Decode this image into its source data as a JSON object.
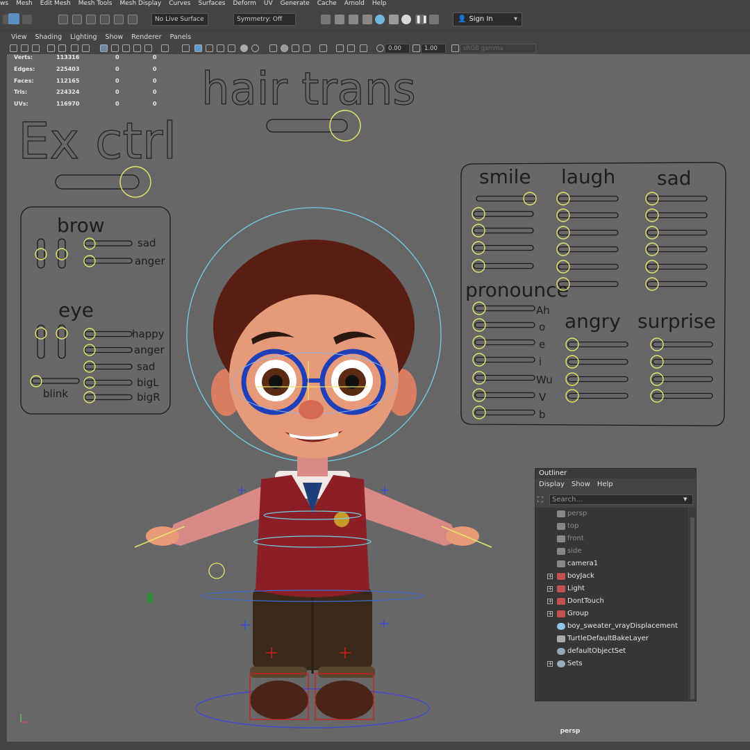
{
  "menubar": [
    "ws",
    "Mesh",
    "Edit Mesh",
    "Mesh Tools",
    "Mesh Display",
    "Curves",
    "Surfaces",
    "Deform",
    "UV",
    "Generate",
    "Cache",
    "Arnold",
    "Help"
  ],
  "toolbar": {
    "live_surface": "No Live Surface",
    "symmetry": "Symmetry: Off",
    "sign_in": "Sign In"
  },
  "panel_menu": [
    "View",
    "Shading",
    "Lighting",
    "Show",
    "Renderer",
    "Panels"
  ],
  "panel_toolbar": {
    "value_a": "0.00",
    "value_b": "1.00",
    "color_space": "sRGB gamma"
  },
  "hud": [
    {
      "label": "Verts:",
      "a": "113316",
      "b": "0",
      "c": "0"
    },
    {
      "label": "Edges:",
      "a": "225403",
      "b": "0",
      "c": "0"
    },
    {
      "label": "Faces:",
      "a": "112165",
      "b": "0",
      "c": "0"
    },
    {
      "label": "Tris:",
      "a": "224324",
      "b": "0",
      "c": "0"
    },
    {
      "label": "UVs:",
      "a": "116970",
      "b": "0",
      "c": "0"
    }
  ],
  "rig": {
    "hair_trans": "hair trans",
    "ex_ctrl": "Ex ctrl",
    "brow": {
      "title": "brow",
      "sliders": [
        "sad",
        "anger"
      ]
    },
    "eye": {
      "title": "eye",
      "sliders": [
        "happy",
        "anger",
        "sad",
        "bigL",
        "bigR"
      ],
      "blink": "blink"
    },
    "expressions": {
      "smile": "smile",
      "laugh": "laugh",
      "sad": "sad",
      "pronounce": "pronounce",
      "angry": "angry",
      "surprise": "surprise",
      "phonemes": [
        "Ah",
        "o",
        "e",
        "i",
        "Wu",
        "V",
        "b"
      ]
    }
  },
  "outliner": {
    "title": "Outliner",
    "menu": [
      "Display",
      "Show",
      "Help"
    ],
    "search_placeholder": "Search...",
    "items": [
      {
        "label": "persp",
        "icon": "camera-icon",
        "dim": true
      },
      {
        "label": "top",
        "icon": "camera-icon",
        "dim": true
      },
      {
        "label": "front",
        "icon": "camera-icon",
        "dim": true
      },
      {
        "label": "side",
        "icon": "camera-icon",
        "dim": true
      },
      {
        "label": "camera1",
        "icon": "camera-icon",
        "dim": false
      },
      {
        "label": "boyJack",
        "icon": "group-icon",
        "dim": false,
        "expand": true
      },
      {
        "label": "Light",
        "icon": "group-icon",
        "dim": false,
        "expand": true
      },
      {
        "label": "DontTouch",
        "icon": "group-icon",
        "dim": false,
        "expand": true
      },
      {
        "label": "Group",
        "icon": "group-icon",
        "dim": false,
        "expand": true
      },
      {
        "label": "boy_sweater_vrayDisplacement",
        "icon": "displacement-icon",
        "dim": false
      },
      {
        "label": "TurtleDefaultBakeLayer",
        "icon": "bake-layer-icon",
        "dim": false
      },
      {
        "label": "defaultObjectSet",
        "icon": "set-icon",
        "dim": false
      },
      {
        "label": "Sets",
        "icon": "set-icon",
        "dim": false,
        "expand": true
      }
    ]
  },
  "viewport_label": "persp",
  "colors": {
    "viewport": "#676767",
    "control_yellow": "#e4e66a",
    "rig_blue": "#6fd0ea",
    "selection_red": "#d11d1d"
  }
}
